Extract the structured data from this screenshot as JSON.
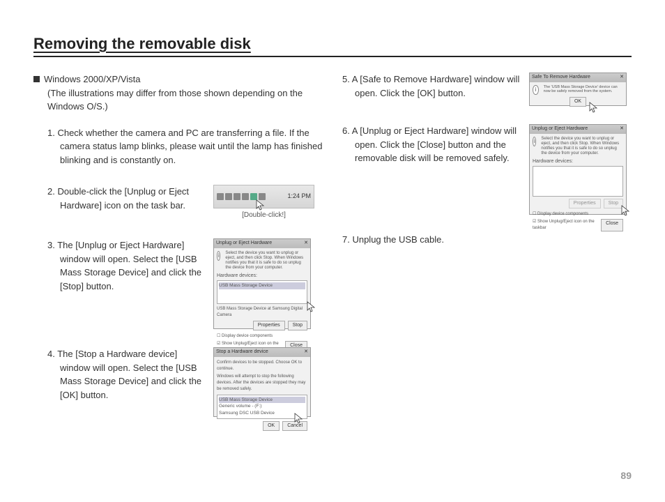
{
  "title": "Removing the removable disk",
  "page_number": "89",
  "intro": {
    "heading": "Windows 2000/XP/Vista",
    "sub": "(The illustrations may differ from those shown depending on the Windows O/S.)"
  },
  "steps": {
    "s1": "1. Check whether the camera and PC are transferring a file. If the camera status lamp blinks, please wait until the lamp has finished blinking and is constantly on.",
    "s2": "2. Double-click the [Unplug or Eject Hardware] icon on the task bar.",
    "s3": "3. The [Unplug or Eject Hardware] window will open. Select the [USB Mass Storage Device] and click the [Stop] button.",
    "s4": "4. The [Stop a Hardware device] window will open. Select the [USB Mass Storage Device] and click the [OK] button.",
    "s5": "5. A [Safe to Remove Hardware] window will open. Click the [OK] button.",
    "s6": "6. A [Unplug or Eject Hardware] window will open. Click the [Close] button and the removable disk will be removed safely.",
    "s7": "7. Unplug the USB cable."
  },
  "taskbar": {
    "clock": "1:24 PM",
    "dblclick_label": "[Double-click!]"
  },
  "dlg3": {
    "title": "Unplug or Eject Hardware",
    "hint": "Select the device you want to unplug or eject, and then click Stop. When Windows notifies you that it is safe to do so unplug the device from your computer.",
    "list_label": "Hardware devices:",
    "item": "USB Mass Storage Device",
    "footer": "USB Mass Storage Device at Samsung Digital Camera",
    "btn_properties": "Properties",
    "btn_stop": "Stop",
    "chk1": "Display device components",
    "chk2": "Show Unplug/Eject icon on the taskbar",
    "btn_close": "Close"
  },
  "dlg4": {
    "title": "Stop a Hardware device",
    "hint1": "Confirm devices to be stopped. Choose OK to continue.",
    "hint2": "Windows will attempt to stop the following devices. After the devices are stopped they may be removed safely.",
    "item1": "USB Mass Storage Device",
    "item2": "Generic volume - (F:)",
    "item3": "Samsung DSC USB Device",
    "btn_ok": "OK",
    "btn_cancel": "Cancel"
  },
  "dlg5": {
    "title": "Safe To Remove Hardware",
    "msg": "The 'USB Mass Storage Device' device can now be safely removed from the system.",
    "btn_ok": "OK"
  },
  "dlg6": {
    "title": "Unplug or Eject Hardware",
    "hint": "Select the device you want to unplug or eject, and then click Stop. When Windows notifies you that it is safe to do so unplug the device from your computer.",
    "list_label": "Hardware devices:",
    "btn_properties": "Properties",
    "btn_stop": "Stop",
    "chk1": "Display device components",
    "chk2": "Show Unplug/Eject icon on the taskbar",
    "btn_close": "Close"
  }
}
